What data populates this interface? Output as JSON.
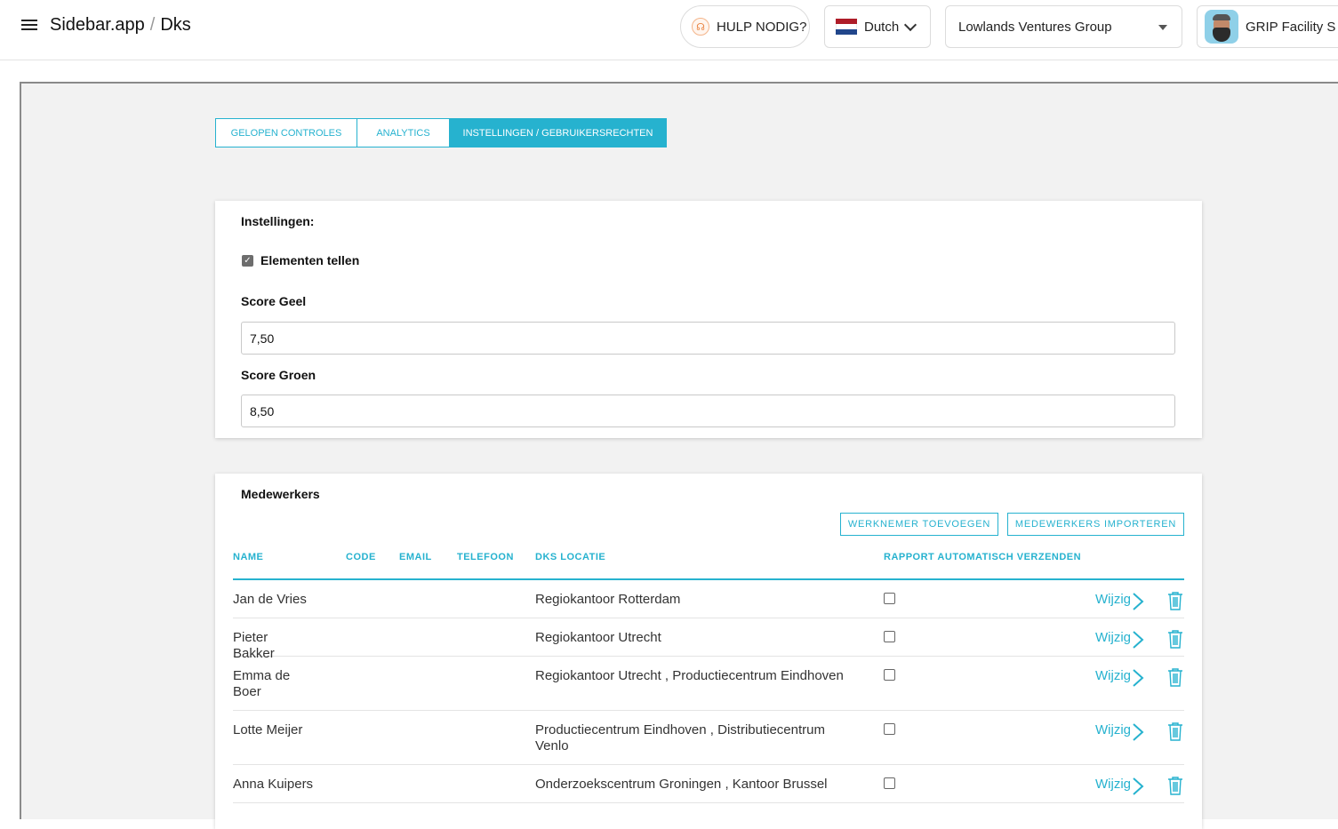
{
  "header": {
    "app": "Sidebar.app",
    "separator": "/",
    "page": "Dks",
    "help_label": "HULP NODIG?",
    "language": "Dutch",
    "organization": "Lowlands Ventures Group",
    "user": "GRIP Facility S"
  },
  "tabs": [
    {
      "label": "GELOPEN CONTROLES",
      "active": false
    },
    {
      "label": "ANALYTICS",
      "active": false
    },
    {
      "label": "INSTELLINGEN / GEBRUIKERSRECHTEN",
      "active": true
    }
  ],
  "settings": {
    "title": "Instellingen:",
    "count_elements_label": "Elementen tellen",
    "count_elements_checked": true,
    "score_yellow_label": "Score Geel",
    "score_yellow_value": "7,50",
    "score_green_label": "Score Groen",
    "score_green_value": "8,50"
  },
  "staff": {
    "title": "Medewerkers",
    "add_button": "WERKNEMER TOEVOEGEN",
    "import_button": "MEDEWERKERS IMPORTEREN",
    "columns": [
      "NAME",
      "CODE",
      "EMAIL",
      "TELEFOON",
      "DKS LOCATIE",
      "RAPPORT AUTOMATISCH VERZENDEN"
    ],
    "edit_label": "Wijzig",
    "rows": [
      {
        "name": "Jan de Vries",
        "code": "",
        "email": "",
        "phone": "",
        "location": "Regiokantoor Rotterdam",
        "auto_report": false
      },
      {
        "name": "Pieter Bakker",
        "code": "",
        "email": "",
        "phone": "",
        "location": "Regiokantoor Utrecht",
        "auto_report": false
      },
      {
        "name": "Emma de Boer",
        "code": "",
        "email": "",
        "phone": "",
        "location": "Regiokantoor Utrecht , Productiecentrum Eindhoven",
        "auto_report": false
      },
      {
        "name": "Lotte Meijer",
        "code": "",
        "email": "",
        "phone": "",
        "location": "Productiecentrum Eindhoven , Distributiecentrum Venlo",
        "auto_report": false
      },
      {
        "name": "Anna Kuipers",
        "code": "",
        "email": "",
        "phone": "",
        "location": "Onderzoekscentrum Groningen , Kantoor Brussel",
        "auto_report": false
      }
    ]
  },
  "colors": {
    "accent": "#26b2cf",
    "workspace_bg": "#f2f2f2",
    "flag_red": "#ae1c28",
    "flag_white": "#ffffff",
    "flag_blue": "#21468b"
  }
}
